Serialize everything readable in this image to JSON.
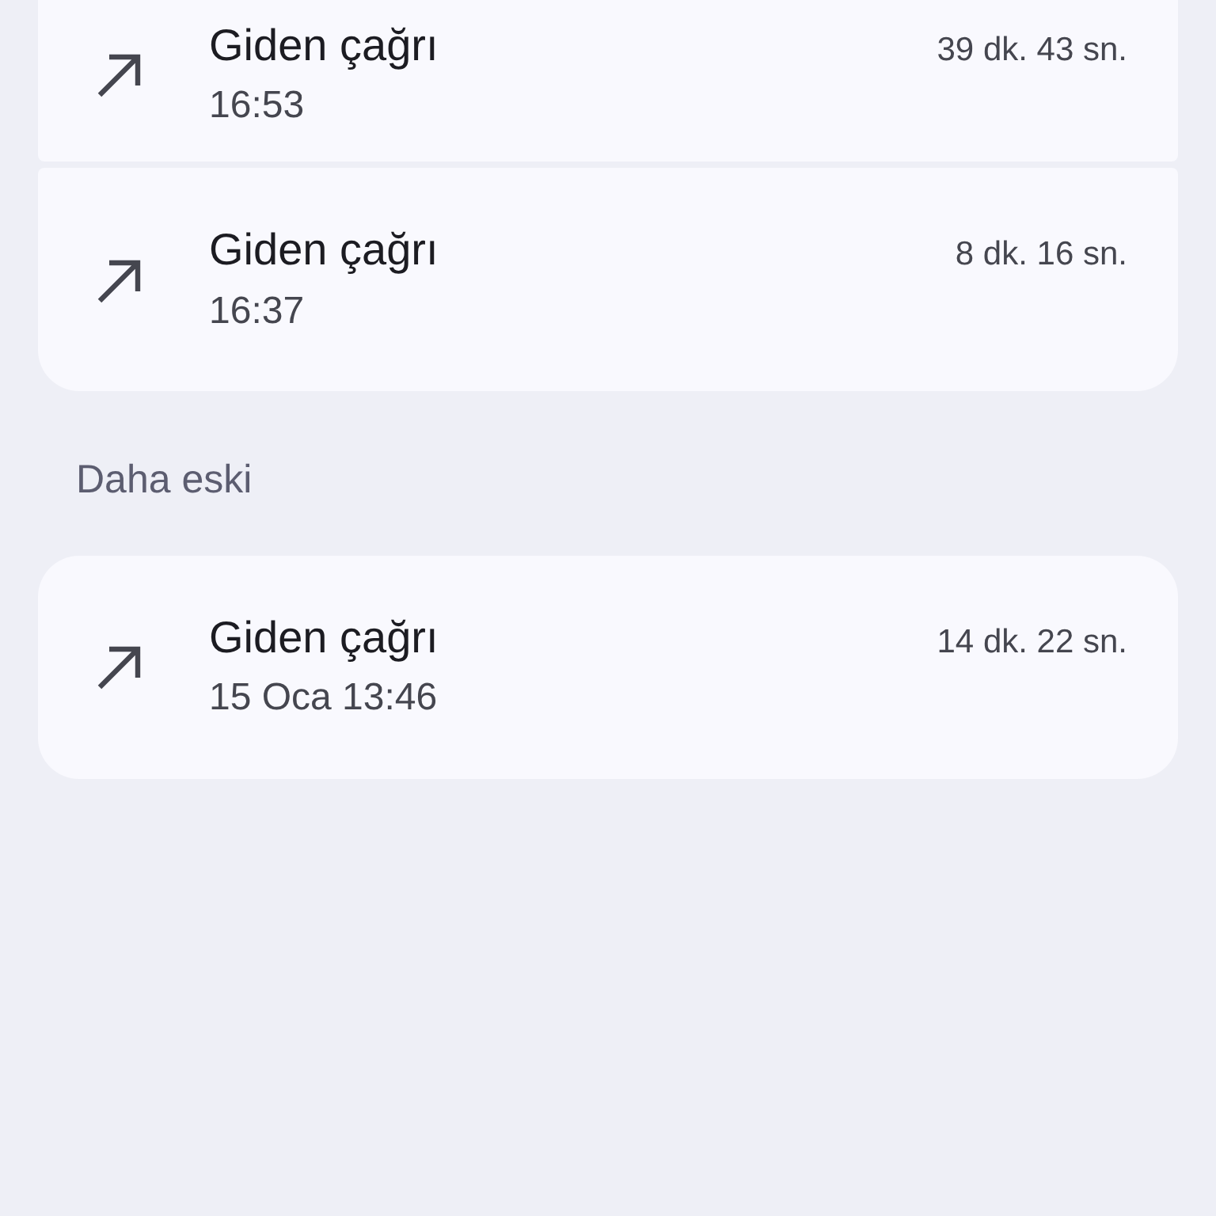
{
  "groups": [
    {
      "calls": [
        {
          "kind": "outgoing",
          "title": "Giden çağrı",
          "time": "16:53",
          "duration": "39 dk. 43 sn."
        },
        {
          "kind": "outgoing",
          "title": "Giden çağrı",
          "time": "16:37",
          "duration": "8 dk. 16 sn."
        }
      ]
    },
    {
      "header": "Daha eski",
      "calls": [
        {
          "kind": "outgoing",
          "title": "Giden çağrı",
          "time": "15 Oca 13:46",
          "duration": "14 dk. 22 sn."
        }
      ]
    }
  ]
}
